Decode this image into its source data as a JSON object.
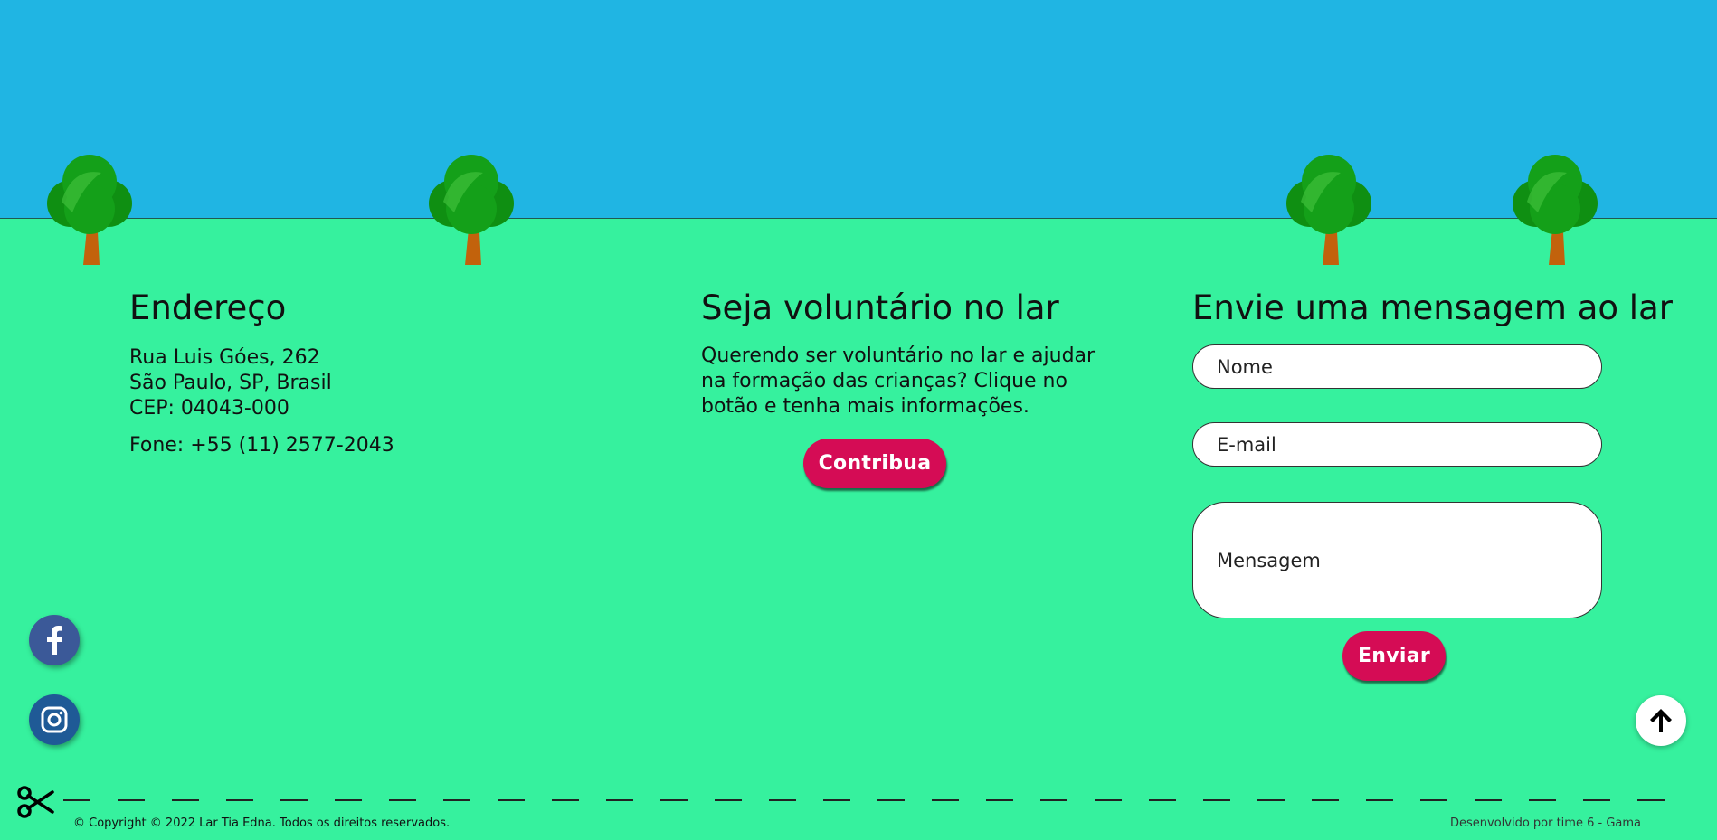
{
  "colors": {
    "sky": "#20b5e3",
    "grass": "#36f19e",
    "button": "#d50c55",
    "facebook": "#3b5998",
    "instagram": "#1f5a96"
  },
  "decor": {
    "tree_icon": "tree-icon",
    "tree_count": 4
  },
  "address": {
    "title": "Endereço",
    "line1": "Rua Luis Góes, 262",
    "line2": "São Paulo, SP, Brasil",
    "line3": "CEP: 04043-000",
    "phone": "Fone: +55 (11) 2577-2043"
  },
  "volunteer": {
    "title": "Seja voluntário no lar",
    "text": "Querendo ser voluntário no lar e ajudar na formação das crianças? Clique no botão e tenha mais informações.",
    "button_label": "Contribua"
  },
  "message_form": {
    "title": "Envie uma mensagem ao lar",
    "name_placeholder": "Nome",
    "email_placeholder": "E-mail",
    "message_placeholder": "Mensagem",
    "submit_label": "Enviar"
  },
  "social": {
    "facebook_icon": "facebook-icon",
    "instagram_icon": "instagram-icon"
  },
  "back_to_top": {
    "icon": "arrow-up-icon"
  },
  "footer": {
    "copyright": "© Copyright © 2022 Lar Tia Edna. Todos os direitos reservados.",
    "developer": "Desenvolvido por time 6 - Gama",
    "cut_icon": "scissors-icon"
  }
}
